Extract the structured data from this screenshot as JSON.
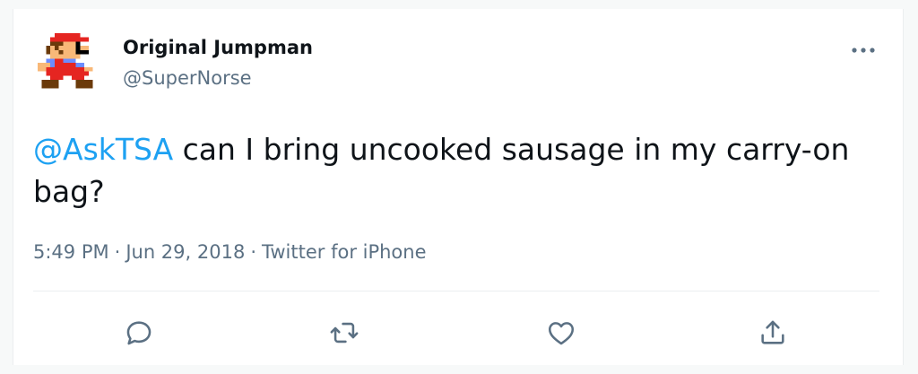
{
  "tweet": {
    "author": {
      "display_name": "Original Jumpman",
      "handle": "@SuperNorse",
      "avatar_icon": "pixel-mario-avatar"
    },
    "text": {
      "mention": "@AskTSA",
      "body": " can I bring uncooked sausage in my carry-on bag?"
    },
    "meta": {
      "time": "5:49 PM",
      "separator": "·",
      "date": "Jun 29, 2018",
      "source": "Twitter for iPhone"
    },
    "actions": [
      "reply-icon",
      "retweet-icon",
      "like-icon",
      "share-icon"
    ]
  },
  "colors": {
    "mention": "#1da1f2",
    "secondary_text": "#5b7083",
    "icon": "#5b7083",
    "primary_text": "#0f1419"
  }
}
